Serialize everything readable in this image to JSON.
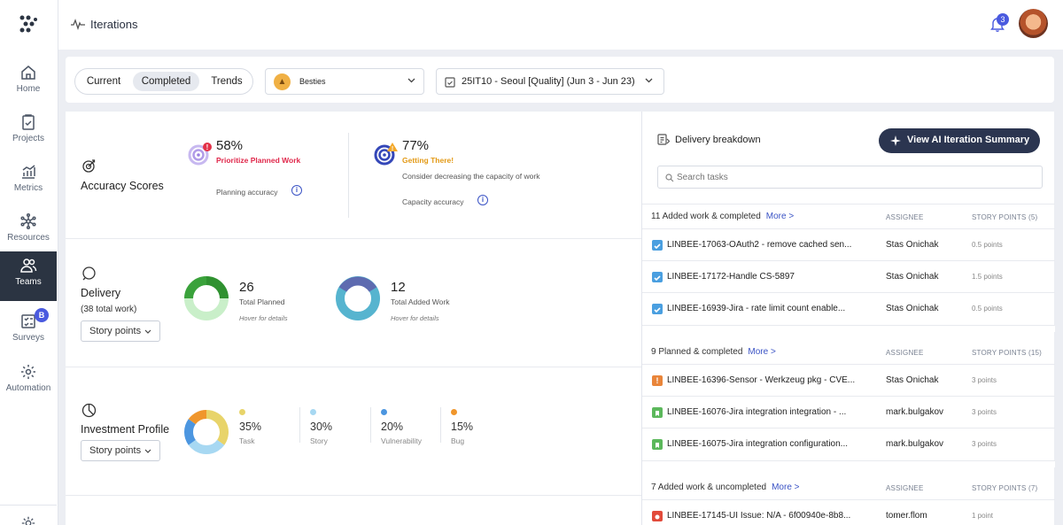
{
  "nav": {
    "items": [
      {
        "label": "Home"
      },
      {
        "label": "Projects"
      },
      {
        "label": "Metrics"
      },
      {
        "label": "Resources"
      },
      {
        "label": "Teams"
      },
      {
        "label": "Surveys",
        "badge": "B"
      },
      {
        "label": "Automation"
      }
    ]
  },
  "header": {
    "title": "Iterations",
    "notifications": "3"
  },
  "filters": {
    "tabs": [
      "Current",
      "Completed",
      "Trends"
    ],
    "active_tab": "Completed",
    "team": "Besties",
    "iteration": "25IT10 - Seoul [Quality] (Jun 3 - Jun 23)"
  },
  "accuracy": {
    "title": "Accuracy Scores",
    "planning": {
      "value": "58%",
      "status": "Prioritize Planned Work",
      "label": "Planning accuracy",
      "score": 0.58
    },
    "capacity": {
      "value": "77%",
      "status": "Getting There!",
      "note": "Consider decreasing the capacity of work",
      "label": "Capacity accuracy",
      "score": 0.77
    }
  },
  "delivery": {
    "title": "Delivery",
    "subtitle": "(38 total work)",
    "unit_button": "Story points",
    "planned": {
      "value": "26",
      "label": "Total Planned",
      "hover": "Hover for details"
    },
    "added": {
      "value": "12",
      "label": "Total Added Work",
      "hover": "Hover for details"
    }
  },
  "investment": {
    "title": "Investment Profile",
    "unit_button": "Story points",
    "items": [
      {
        "pct": "35%",
        "label": "Task",
        "color": "#e8d46a",
        "value": 35
      },
      {
        "pct": "30%",
        "label": "Story",
        "color": "#a7d8f2",
        "value": 30
      },
      {
        "pct": "20%",
        "label": "Vulnerability",
        "color": "#4c96e0",
        "value": 20
      },
      {
        "pct": "15%",
        "label": "Bug",
        "color": "#f0962c",
        "value": 15
      }
    ]
  },
  "breakdown": {
    "title": "Delivery breakdown",
    "ai_button": "View AI Iteration Summary",
    "search_placeholder": "Search tasks",
    "col_assignee": "ASSIGNEE",
    "groups": [
      {
        "title": "11 Added work & completed",
        "more": "More >",
        "points_header": "STORY POINTS (5)",
        "tasks": [
          {
            "name": "LINBEE-17063-OAuth2 - remove cached sen...",
            "assignee": "Stas Onichak",
            "points": "0.5 points",
            "type": "check"
          },
          {
            "name": "LINBEE-17172-Handle CS-5897",
            "assignee": "Stas Onichak",
            "points": "1.5 points",
            "type": "check"
          },
          {
            "name": "LINBEE-16939-Jira - rate limit count enable...",
            "assignee": "Stas Onichak",
            "points": "0.5 points",
            "type": "check"
          }
        ]
      },
      {
        "title": "9 Planned & completed",
        "more": "More >",
        "points_header": "STORY POINTS (15)",
        "tasks": [
          {
            "name": "LINBEE-16396-Sensor - Werkzeug pkg - CVE...",
            "assignee": "Stas Onichak",
            "points": "3 points",
            "type": "vuln"
          },
          {
            "name": "LINBEE-16076-Jira integration integration - ...",
            "assignee": "mark.bulgakov",
            "points": "3 points",
            "type": "story"
          },
          {
            "name": "LINBEE-16075-Jira integration configuration...",
            "assignee": "mark.bulgakov",
            "points": "3 points",
            "type": "story"
          }
        ]
      },
      {
        "title": "7 Added work & uncompleted",
        "more": "More >",
        "points_header": "STORY POINTS (7)",
        "tasks": [
          {
            "name": "LINBEE-17145-UI Issue: N/A - 6f00940e-8b8...",
            "assignee": "tomer.flom",
            "points": "1 point",
            "type": "bug"
          }
        ]
      }
    ]
  }
}
